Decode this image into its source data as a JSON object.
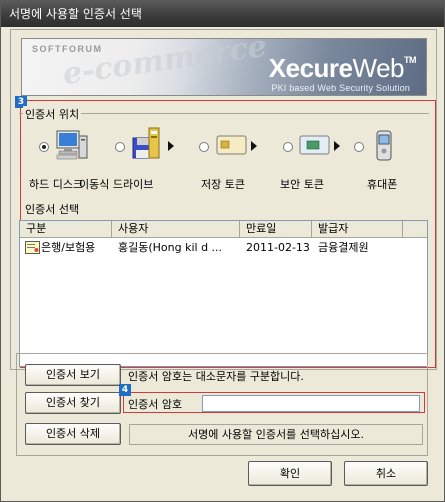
{
  "window": {
    "title": "서명에 사용할 인증서 선택"
  },
  "banner": {
    "company": "SOFTFORUM",
    "product_bold": "Xecure",
    "product_light": "Web",
    "trademark": "TM",
    "tagline": "PKI based Web Security Solution",
    "background_text": "e-commerce"
  },
  "markers": {
    "location": "3",
    "password": "4"
  },
  "location": {
    "group_label": "인증서 위치",
    "devices": [
      {
        "label": "하드 디스크",
        "icon": "computer-icon",
        "selected": true
      },
      {
        "label": "이동식 드라이브",
        "icon": "removable-drive-icon",
        "selected": false
      },
      {
        "label": "저장 토큰",
        "icon": "storage-token-icon",
        "selected": false
      },
      {
        "label": "보안 토큰",
        "icon": "security-token-icon",
        "selected": false
      },
      {
        "label": "휴대폰",
        "icon": "mobile-phone-icon",
        "selected": false
      }
    ]
  },
  "selection": {
    "group_label": "인증서 선택",
    "columns": [
      "구분",
      "사용자",
      "만료일",
      "발급자"
    ],
    "rows": [
      {
        "type": "은행/보험용",
        "user": "홍길동(Hong kil d ...",
        "expiry": "2011-02-13",
        "issuer": "금융결제원",
        "icon": "certificate-icon"
      }
    ]
  },
  "actions": {
    "view_cert": "인증서 보기",
    "find_cert": "인증서 찾기",
    "delete_cert": "인증서 삭제",
    "case_notice": "인증서 암호는 대소문자를 구분합니다.",
    "password_label": "인증서 암호",
    "password_value": "",
    "status": "서명에 사용할 인증서를 선택하십시오."
  },
  "dialog": {
    "ok": "확인",
    "cancel": "취소"
  },
  "colors": {
    "title_bar": "#3a3a3a",
    "highlight": "#d33a3a",
    "marker": "#1f6fc5"
  }
}
